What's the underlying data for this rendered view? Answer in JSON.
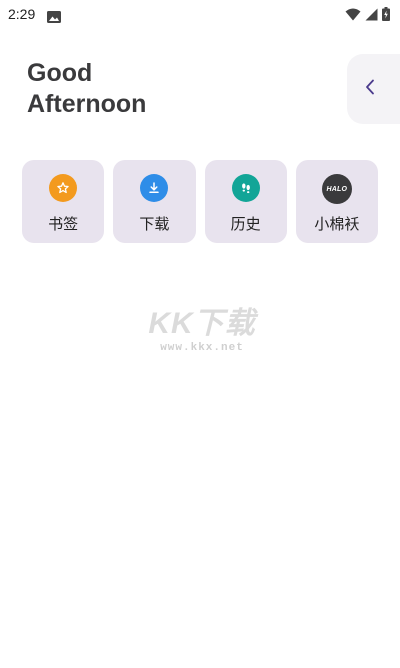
{
  "status_bar": {
    "time": "2:29",
    "icons": [
      "gallery-icon",
      "wifi-icon",
      "cellular-icon",
      "battery-charging-icon"
    ]
  },
  "greeting": {
    "line1": "Good",
    "line2": "Afternoon"
  },
  "collapse_button": {
    "icon": "chevron-left-icon"
  },
  "tiles": [
    {
      "label": "书签",
      "icon": "star-bookmark-icon",
      "color": "#F39A1E"
    },
    {
      "label": "下载",
      "icon": "download-icon",
      "color": "#2E8DE8"
    },
    {
      "label": "历史",
      "icon": "footprints-icon",
      "color": "#12A597"
    },
    {
      "label": "小棉袄",
      "icon": "halo-logo-icon",
      "icon_text": "HALO",
      "color": "#3A3A3C"
    }
  ],
  "watermark": {
    "logo": "KK下载",
    "url": "www.kkx.net"
  },
  "colors": {
    "tile_background": "#E8E3EE",
    "greeting_text": "#3A3A3C",
    "collapse_background": "#F4F3F6",
    "accent": "#4A3A8C"
  }
}
